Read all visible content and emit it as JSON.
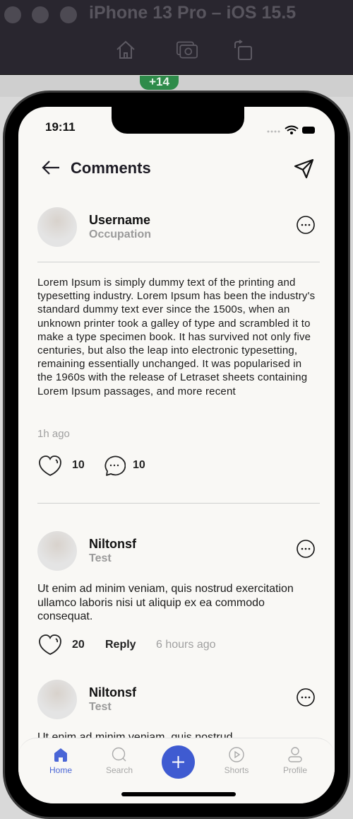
{
  "window": {
    "title": "iPhone 13 Pro – iOS 15.5",
    "badge": "+14"
  },
  "status": {
    "time": "19:11"
  },
  "header": {
    "title": "Comments"
  },
  "post": {
    "username": "Username",
    "occupation": "Occupation",
    "text": "Lorem Ipsum is simply dummy text of the printing and typesetting industry. Lorem Ipsum has been the industry's standard dummy text ever since the 1500s, when an unknown printer took a galley of type and scrambled it to make a type specimen book. It has survived not only five centuries, but also the leap into electronic typesetting, remaining essentially unchanged. It was popularised in the 1960s with the release of Letraset sheets containing Lorem Ipsum passages, and more recent",
    "time": "1h ago",
    "likes": "10",
    "comments": "10"
  },
  "comments": [
    {
      "username": "Niltonsf",
      "occupation": "Test",
      "text": "Ut enim ad minim veniam, quis nostrud exercitation ullamco laboris nisi ut aliquip ex ea commodo consequat.",
      "likes": "20",
      "reply": "Reply",
      "time": "6 hours ago"
    },
    {
      "username": "Niltonsf",
      "occupation": "Test",
      "text": "Ut enim ad minim veniam, quis nostrud"
    }
  ],
  "nav": {
    "items": [
      {
        "label": "Home",
        "icon": "home-icon",
        "active": true
      },
      {
        "label": "Search",
        "icon": "search-icon"
      },
      {
        "label": "",
        "icon": "plus-icon"
      },
      {
        "label": "Shorts",
        "icon": "play-icon"
      },
      {
        "label": "Profile",
        "icon": "profile-icon"
      }
    ],
    "accent": "#3f5bd1"
  }
}
